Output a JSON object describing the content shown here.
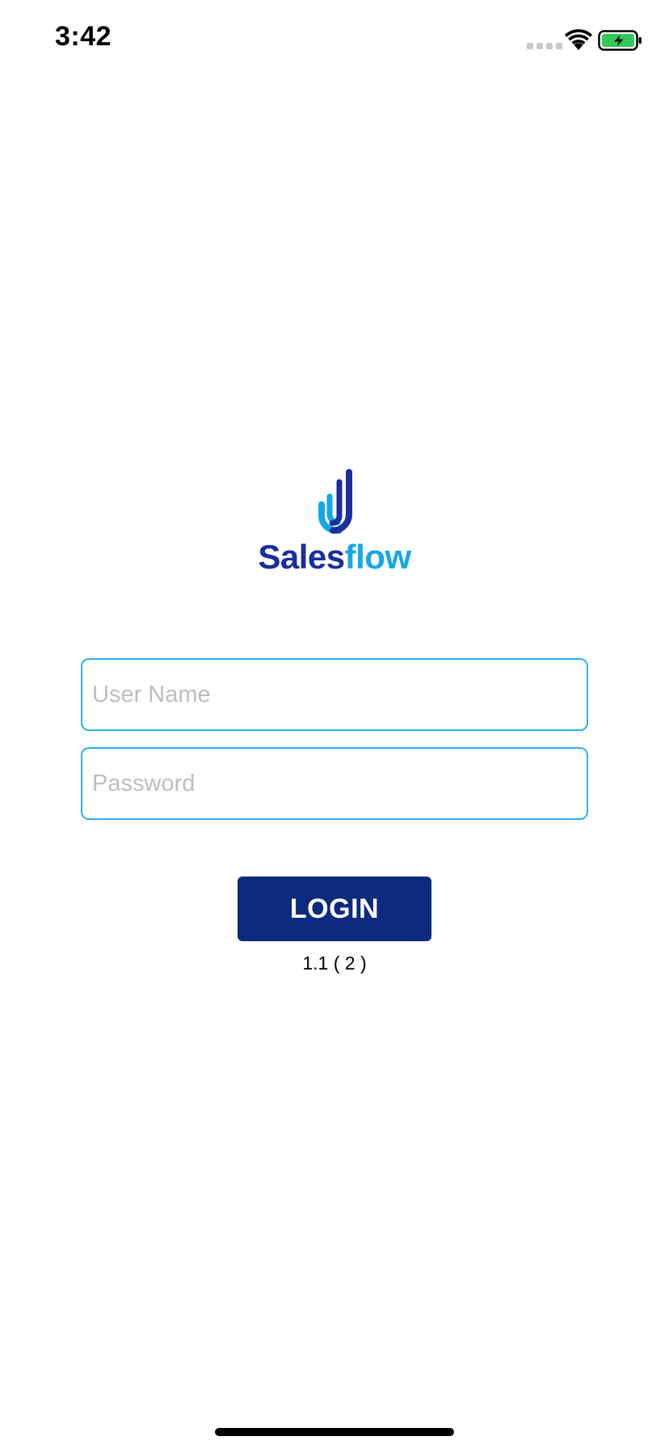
{
  "status_bar": {
    "time": "3:42",
    "signal_icon": "cellular-signal-icon",
    "wifi_icon": "wifi-icon",
    "battery_icon": "battery-charging-icon",
    "battery_color": "#34c759"
  },
  "logo": {
    "icon": "salesflow-logo-icon",
    "word_part1": "Sales",
    "word_part2": "flow",
    "color_primary": "#1a2f9b",
    "color_accent": "#16a6ea"
  },
  "login_form": {
    "username_placeholder": "User Name",
    "username_value": "",
    "password_placeholder": "Password",
    "password_value": "",
    "login_label": "LOGIN",
    "field_border_color": "#2cb2ef",
    "button_color": "#0c2a7e"
  },
  "footer": {
    "version": "1.1 ( 2 )"
  }
}
